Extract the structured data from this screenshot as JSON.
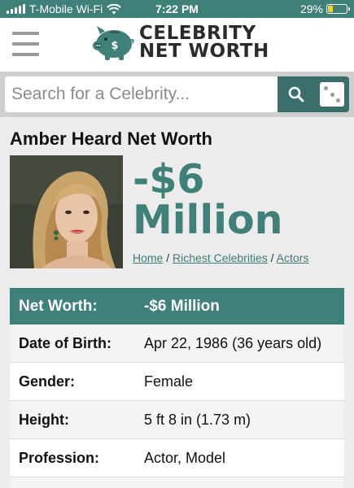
{
  "status_bar": {
    "carrier": "T-Mobile Wi-Fi",
    "time": "7:22 PM",
    "battery": "29%",
    "battery_level": 0.29
  },
  "header": {
    "logo_line1": "CELEBRITY",
    "logo_line2": "NET WORTH"
  },
  "search": {
    "placeholder": "Search for a Celebrity..."
  },
  "title": {
    "name": "Amber Heard",
    "suffix": " Net Worth"
  },
  "net_worth_big": {
    "line1": "-$6",
    "line2": "Million"
  },
  "breadcrumb": {
    "home": "Home",
    "sep1": " / ",
    "richest": "Richest Celebrities",
    "sep2": " / ",
    "actors": "Actors"
  },
  "facts": {
    "rows": [
      {
        "label": "Net Worth:",
        "value": "-$6 Million"
      },
      {
        "label": "Date of Birth:",
        "value": "Apr 22, 1986 (36 years old)"
      },
      {
        "label": "Gender:",
        "value": "Female"
      },
      {
        "label": "Height:",
        "value": "5 ft 8 in (1.73 m)"
      },
      {
        "label": "Profession:",
        "value": "Actor, Model"
      }
    ]
  },
  "colors": {
    "accent": "#3f8079",
    "search_button": "#3a6f6b",
    "battery": "#f7d22a"
  }
}
